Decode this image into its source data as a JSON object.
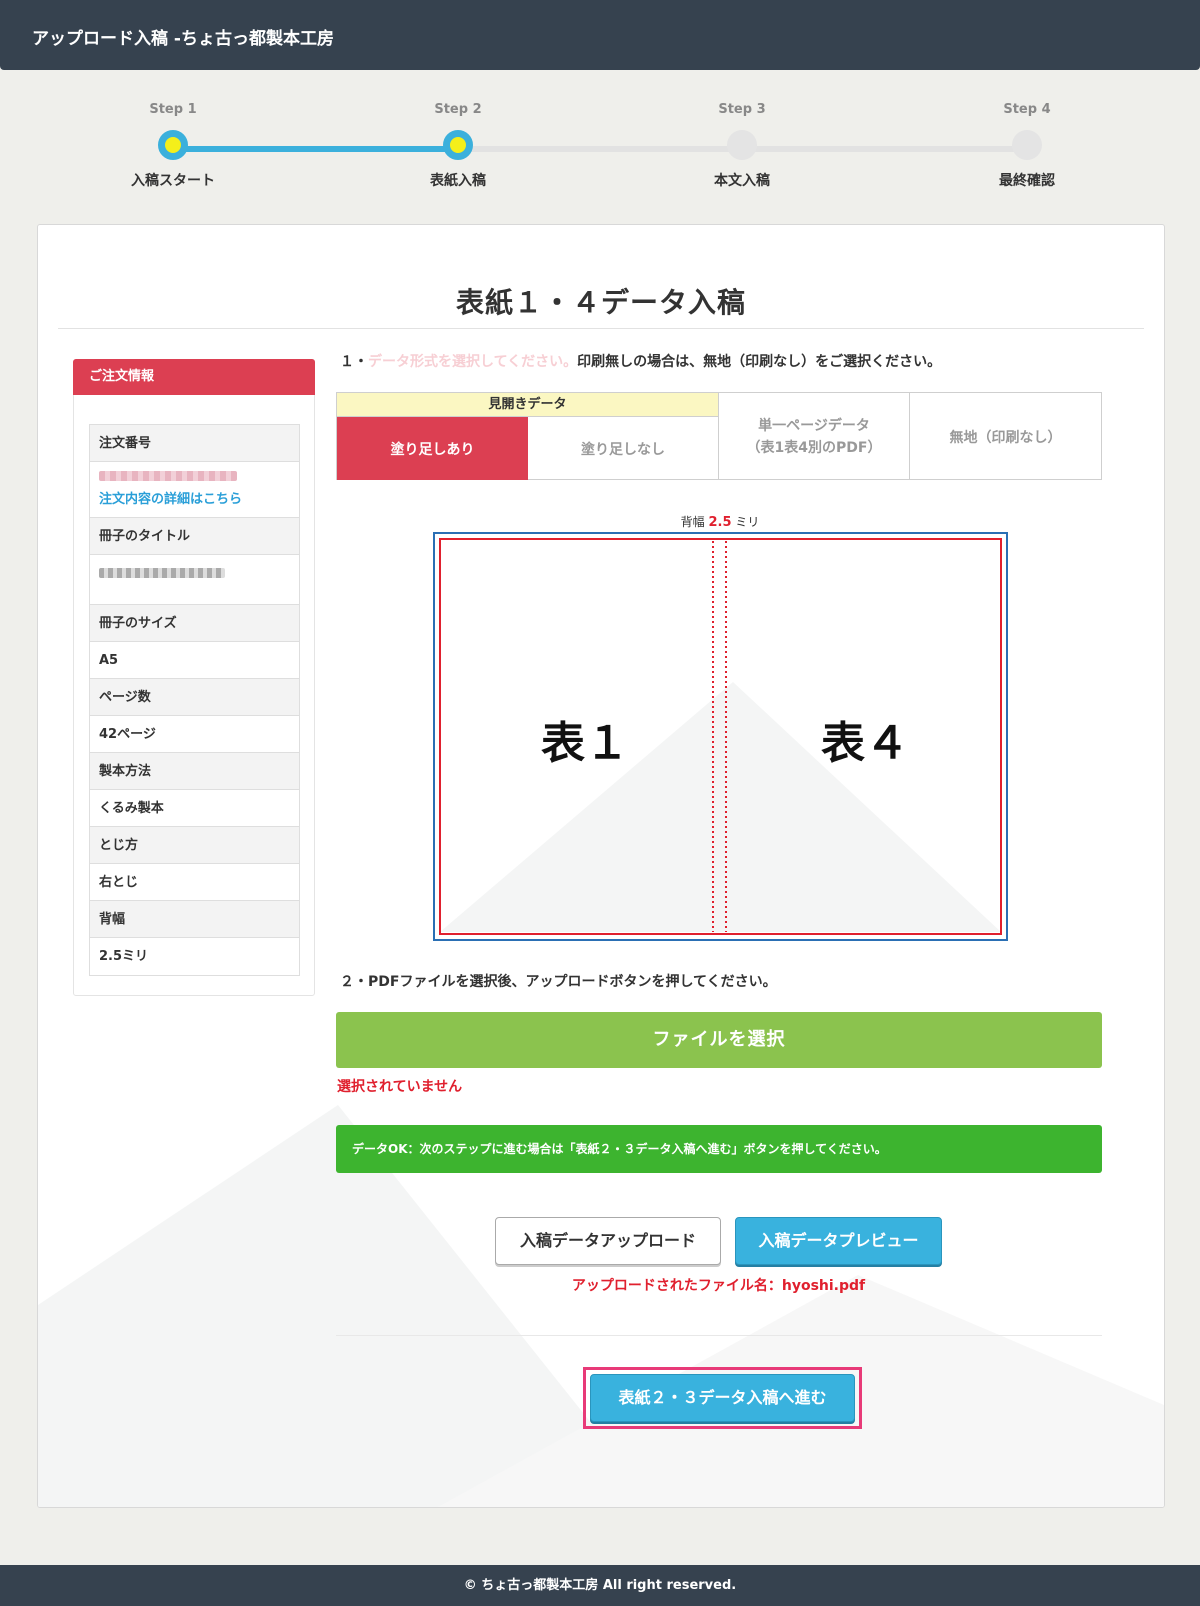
{
  "header": {
    "title": "アップロード入稿 -ちょ古っ都製本工房"
  },
  "stepper": {
    "current_step": 2,
    "steps": [
      {
        "label": "Step 1",
        "name": "入稿スタート",
        "active": true
      },
      {
        "label": "Step 2",
        "name": "表紙入稿",
        "active": true
      },
      {
        "label": "Step 3",
        "name": "本文入稿",
        "active": false
      },
      {
        "label": "Step 4",
        "name": "最終確認",
        "active": false
      }
    ]
  },
  "main": {
    "heading": "表紙１・４データ入稿",
    "instruction1": {
      "prefix": "１・",
      "faint": "データ形式を選択してください。",
      "rest": "印刷無しの場合は、無地（印刷なし）をご選択ください。"
    },
    "format": {
      "group_label": "見開きデータ",
      "option_bleed": "塗り足しあり",
      "option_nobleed": "塗り足しなし",
      "option_single_line1": "単一ページデータ",
      "option_single_line2": "（表1表4別のPDF）",
      "option_blank": "無地（印刷なし）",
      "selected": "塗り足しあり"
    },
    "diagram": {
      "spine_prefix": "背幅",
      "spine_value": "2.5",
      "spine_unit": "ミリ",
      "cover1": "表１",
      "cover4": "表４"
    },
    "instruction2": "２・PDFファイルを選択後、アップロードボタンを押してください。",
    "file_button": "ファイルを選択",
    "no_file": "選択されていません",
    "data_ok": "データOK：次のステップに進む場合は「表紙２・３データ入稿へ進む」ボタンを押してください。",
    "upload_button": "入稿データアップロード",
    "preview_button": "入稿データプレビュー",
    "uploaded_file": "アップロードされたファイル名：hyoshi.pdf",
    "next_button": "表紙２・３データ入稿へ進む"
  },
  "sidebar": {
    "title": "ご注文情報",
    "order_number_label": "注文番号",
    "order_detail_link": "注文内容の詳細はこちら",
    "book_title_label": "冊子のタイトル",
    "size_label": "冊子のサイズ",
    "size_value": "A5",
    "pages_label": "ページ数",
    "pages_value": "42ページ",
    "binding_label": "製本方法",
    "binding_value": "くるみ製本",
    "side_label": "とじ方",
    "side_value": "右とじ",
    "spine_label": "背幅",
    "spine_value": "2.5ミリ"
  },
  "footer": {
    "copyright": "© ちょ古っ都製本工房 All right reserved."
  },
  "colors": {
    "header_bg": "#36424f",
    "accent_red": "#dc3f52",
    "accent_blue": "#39b2de",
    "green_button": "#8bc34e",
    "ok_green": "#3db42f",
    "error_red": "#e0202e",
    "highlight_pink": "#e83a78"
  }
}
